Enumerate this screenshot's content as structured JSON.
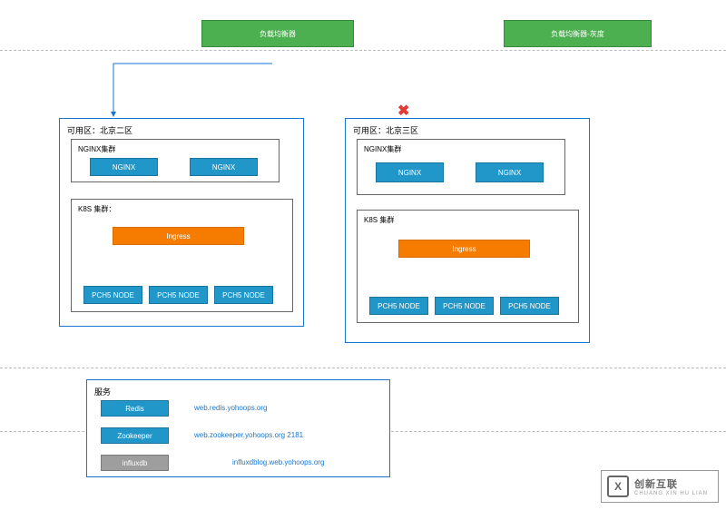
{
  "top": {
    "lb_main": "负载均衡器",
    "lb_gray": "负载均衡器-灰度"
  },
  "x_mark": "✖",
  "zone2": {
    "title": "可用区：北京二区",
    "nginx": {
      "title": "NGINX集群",
      "n1": "NGINX",
      "n2": "NGINX"
    },
    "k8s": {
      "title": "K8S 集群：",
      "ingress": "Ingress",
      "node1": "PCH5 NODE",
      "node2": "PCH5 NODE",
      "node3": "PCH5 NODE"
    }
  },
  "zone3": {
    "title": "可用区：北京三区",
    "nginx": {
      "title": "NGINX集群",
      "n1": "NGINX",
      "n2": "NGINX"
    },
    "k8s": {
      "title": "K8S 集群",
      "ingress": "Ingress",
      "node1": "PCH5 NODE",
      "node2": "PCH5 NODE",
      "node3": "PCH5 NODE"
    }
  },
  "services": {
    "title": "服务",
    "redis": {
      "label": "Redis",
      "url": "web.redis.yohoops.org"
    },
    "zk": {
      "label": "Zookeeper",
      "url": "web.zookeeper.yohoops.org 2181"
    },
    "influx": {
      "label": "influxdb",
      "url": "influxdblog.web.yohoops.org"
    }
  },
  "watermark": {
    "logo": "X",
    "main": "创新互联",
    "sub": "CHUANG XIN HU LIAN"
  }
}
